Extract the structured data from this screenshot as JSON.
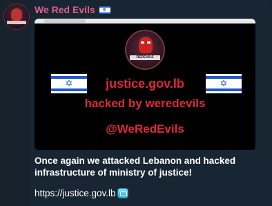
{
  "channel": {
    "name": "We Red Evils",
    "name_flag": "israel-flag-emoji"
  },
  "media": {
    "logo_label": "REDEVILS",
    "line1": "justice.gov.lb",
    "line2": "hacked by weredevils",
    "line3": "@WeRedEvils",
    "colors": {
      "text": "#e2283a",
      "background": "#000000",
      "flag_blue": "#1f57c9"
    }
  },
  "message": {
    "text": "Once again we attacked Lebanon and hacked infrastructure of ministry of justice!",
    "link": "https://justice.gov.lb",
    "link_emoji": "cool-button-emoji"
  },
  "colors": {
    "channel_name": "#e0608a",
    "bubble": "#182533"
  }
}
